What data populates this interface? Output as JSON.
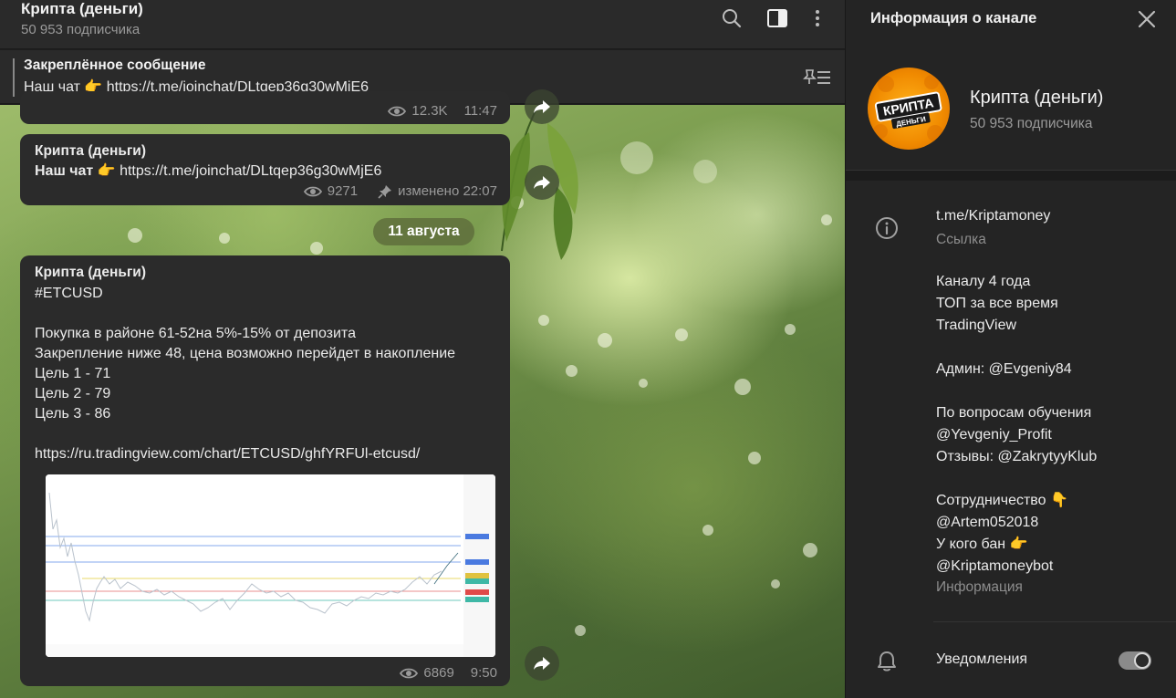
{
  "header": {
    "channel_name": "Крипта (деньги)",
    "subscribers": "50 953 подписчика",
    "icons": [
      "search-icon",
      "sidebar-toggle-icon",
      "more-vertical-icon"
    ]
  },
  "pinned": {
    "title": "Закреплённое сообщение",
    "text": "Наш чат 👉 https://t.me/joinchat/DLtqep36g30wMjE6",
    "icon": "pin-list-icon"
  },
  "messages": [
    {
      "views": "12.3K",
      "time": "11:47"
    },
    {
      "author": "Крипта (деньги)",
      "text_bold": "Наш чат",
      "text_rest": " 👉 https://t.me/joinchat/DLtqep36g30wMjE6",
      "views": "9271",
      "edited": "изменено 22:07"
    },
    {
      "author": "Крипта (деньги)",
      "lines": [
        "#ETCUSD",
        "",
        "Покупка в районе 61-52на 5%-15% от депозита",
        "Закрепление ниже 48, цена возможно перейдет в накопление",
        "Цель 1 - 71",
        "Цель 2 - 79",
        "Цель 3 - 86",
        "",
        "https://ru.tradingview.com/chart/ETCUSD/ghfYRFUl-etcusd/"
      ],
      "views": "6869",
      "time": "9:50"
    }
  ],
  "date_separator": "11 августа",
  "info_panel": {
    "header": "Информация о канале",
    "channel_name": "Крипта (деньги)",
    "subscribers": "50 953 подписчика",
    "avatar_text_1": "КРИПТА",
    "avatar_text_2": "ДЕНЬГИ",
    "link": "t.me/Kriptamoney",
    "link_label": "Ссылка",
    "description_lines": [
      "Каналу 4 года",
      "ТОП за все время",
      "TradingView",
      "",
      "Админ: @Evgeniy84",
      "",
      "По вопросам обучения",
      "@Yevgeniy_Profit",
      "Отзывы: @ZakrytyyKlub",
      "",
      "Сотрудничество 👇",
      "@Artem052018",
      "У кого бан 👉",
      "@Kriptamoneybot"
    ],
    "description_label": "Информация",
    "notifications_label": "Уведомления",
    "notifications_on": true
  },
  "colors": {
    "panel_bg": "#2a2a2a",
    "bubble_bg": "#2b2b2b",
    "muted_text": "#9a9a9a",
    "avatar_orange": "#f08a00"
  }
}
